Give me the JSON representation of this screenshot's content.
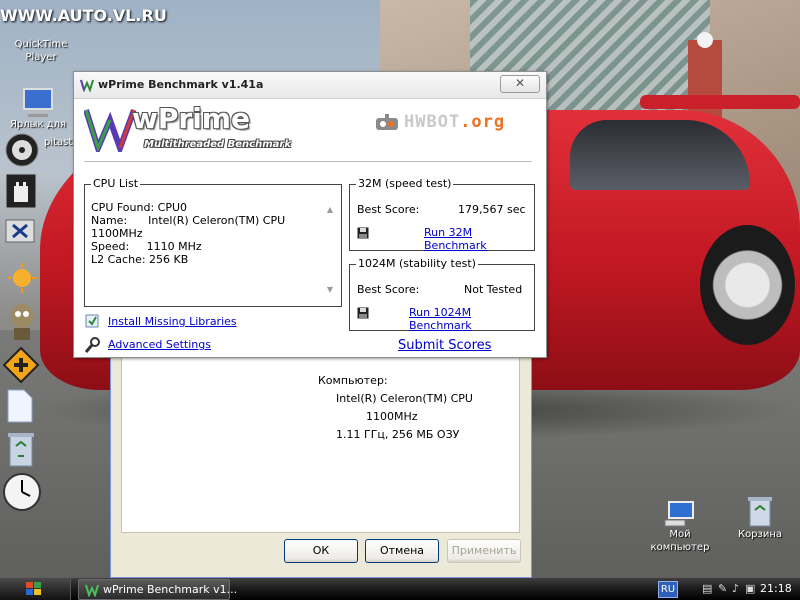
{
  "desktop": {
    "watermark": "WWW.AUTO.VL.RU",
    "icons": [
      {
        "name": "quicktime",
        "label_line1": "QuickTime",
        "label_line2": "Player"
      },
      {
        "name": "lang-shortcut",
        "label_line1": "Ярлык для"
      },
      {
        "name": "pitast",
        "label_line1": "pitast"
      },
      {
        "name": "my-computer",
        "label_line1": "Мой",
        "label_line2": "компьютер"
      },
      {
        "name": "recycle-bin",
        "label_line1": "Корзина"
      }
    ]
  },
  "wprime": {
    "title": "wPrime Benchmark v1.41a",
    "close_glyph": "✕",
    "logo_main": "wPrime",
    "logo_sub": "Multithreaded Benchmark",
    "hwbot_prefix": "HWBOT",
    "hwbot_suffix": ".org",
    "cpu_list": {
      "legend": "CPU List",
      "lines": "CPU Found: CPU0\nName:      Intel(R) Celeron(TM) CPU\n1100MHz\nSpeed:     1110 MHz\nL2 Cache: 256 KB",
      "scroll_up": "▲",
      "scroll_down": "▼"
    },
    "speed_test": {
      "legend": "32M (speed test)",
      "best_score_label": "Best Score:",
      "best_score_value": "179,567 sec",
      "run_label": "Run 32M Benchmark"
    },
    "stability_test": {
      "legend": "1024M (stability test)",
      "best_score_label": "Best Score:",
      "best_score_value": "Not Tested",
      "run_label": "Run 1024M Benchmark"
    },
    "install_libraries": "Install Missing Libraries",
    "advanced_settings": "Advanced Settings",
    "submit_scores": "Submit Scores"
  },
  "properties": {
    "computer_label": "Компьютер:",
    "cpu_line1": "Intel(R) Celeron(TM) CPU",
    "cpu_line2": "1100MHz",
    "cpu_line3": "1.11 ГГц, 256 МБ ОЗУ",
    "ok_label": "ОК",
    "cancel_label": "Отмена",
    "apply_label": "Применить"
  },
  "taskbar": {
    "task_label": "wPrime Benchmark v1...",
    "language": "RU",
    "clock": "21:18"
  },
  "colors": {
    "link": "#0000cc",
    "hwbot_accent": "#f07020",
    "taskbar": "#1a1a1a"
  }
}
